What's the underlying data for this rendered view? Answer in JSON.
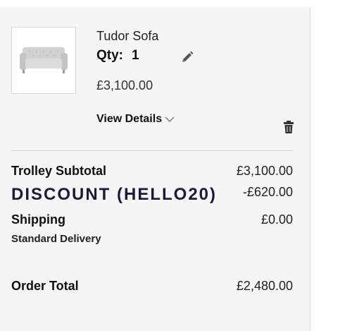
{
  "item": {
    "name": "Tudor Sofa",
    "qty_label": "Qty:",
    "qty_value": "1",
    "price": "£3,100.00",
    "details_label": "View Details",
    "image_icon": "sofa-thumbnail",
    "edit_icon": "pencil-icon",
    "delete_icon": "trash-icon"
  },
  "summary": {
    "subtotal_label": "Trolley Subtotal",
    "subtotal_value": "£3,100.00",
    "discount_label": "DISCOUNT (HELLO20)",
    "discount_value": "-£620.00",
    "shipping_label": "Shipping",
    "shipping_method": "Standard Delivery",
    "shipping_value": "£0.00",
    "total_label": "Order Total",
    "total_value": "£2,480.00"
  },
  "colors": {
    "panel_background": "#f5f5f5",
    "discount_text": "#1c1a3a",
    "divider": "#d4d4d4"
  }
}
